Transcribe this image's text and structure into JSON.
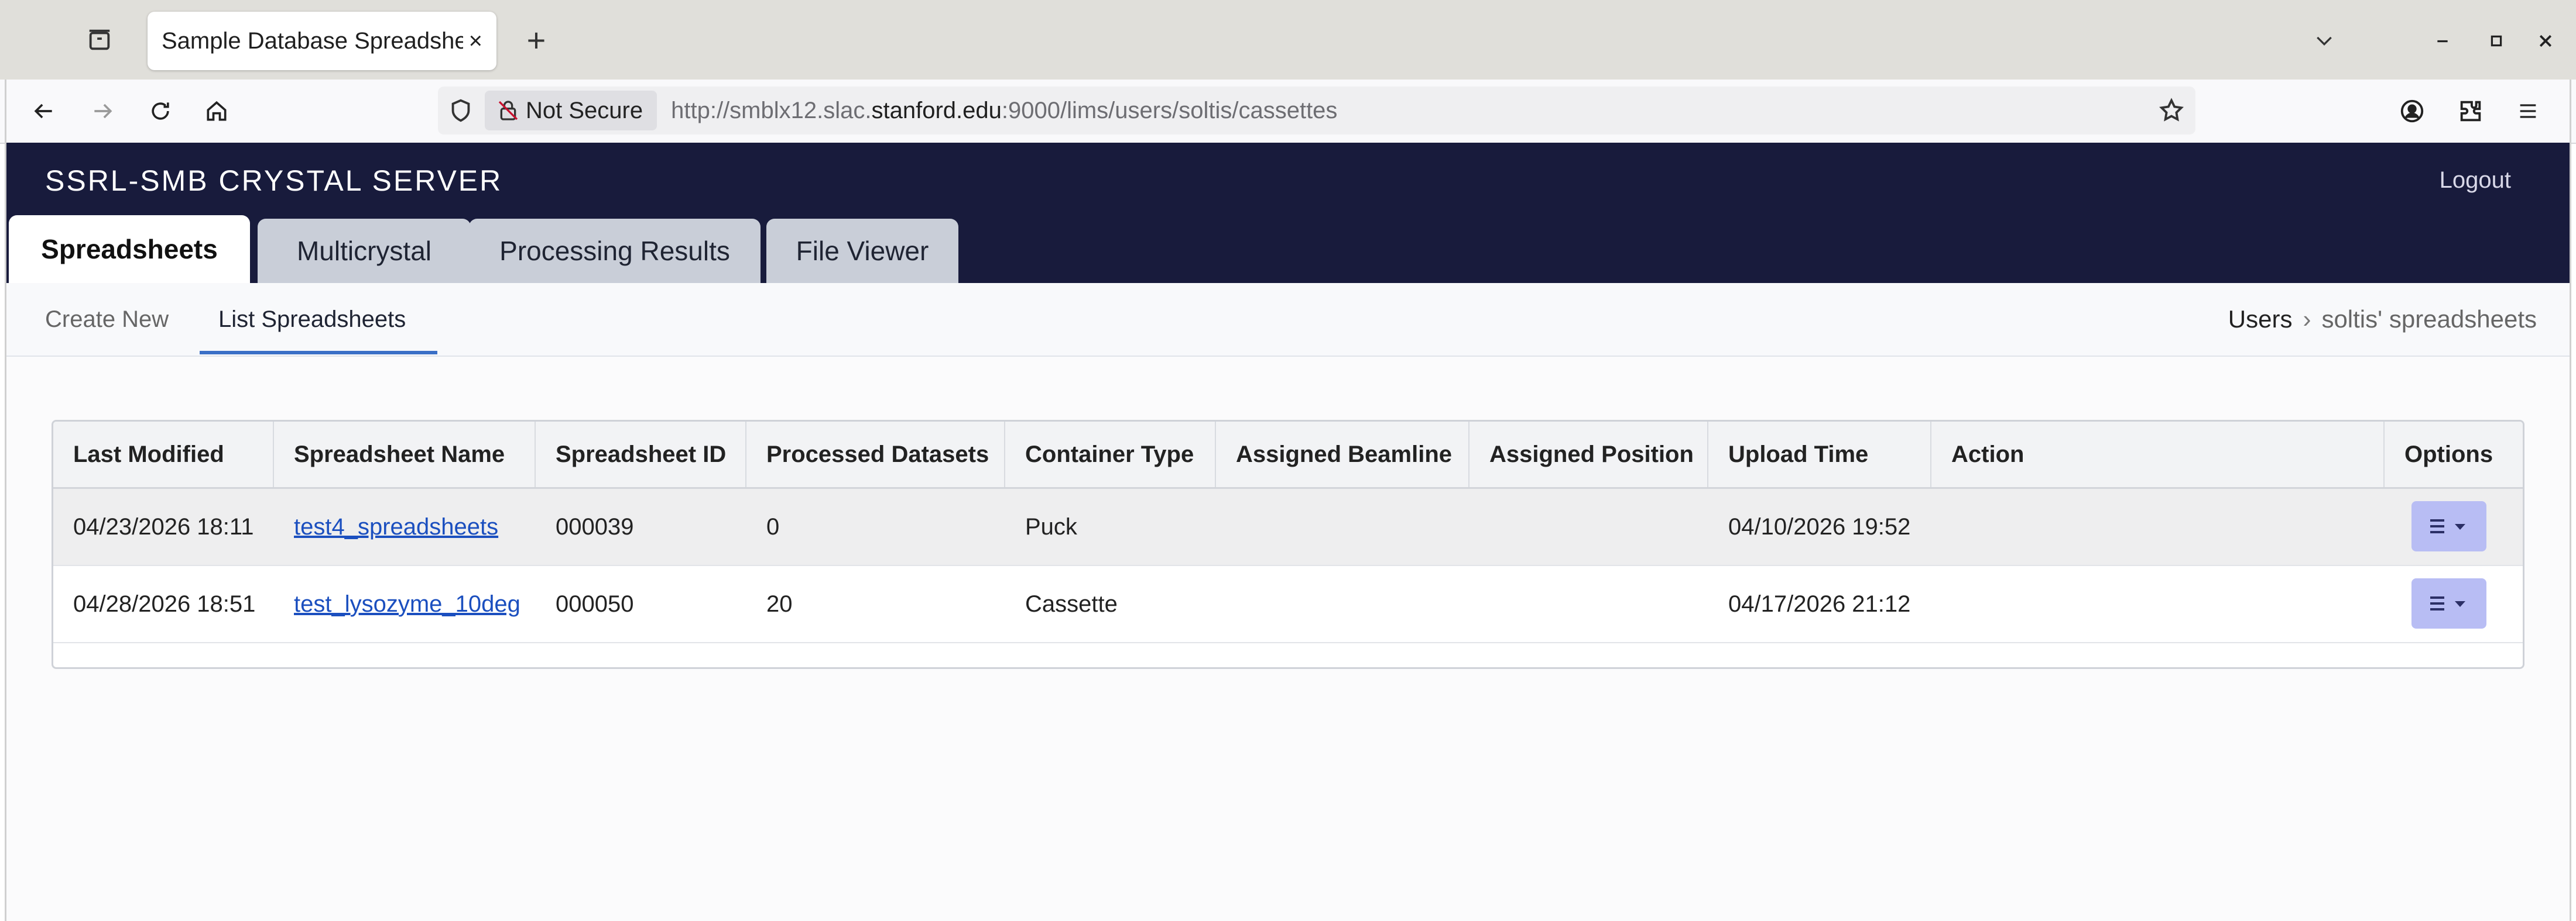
{
  "browser": {
    "tab_title": "Sample Database Spreadsheets",
    "tab_close": "×",
    "new_tab": "+",
    "not_secure": "Not Secure",
    "url_scheme": "http://smblx12.slac.",
    "url_host": "stanford.edu",
    "url_path": ":9000/lims/users/soltis/cassettes"
  },
  "app": {
    "brand": "SSRL-SMB CRYSTAL SERVER",
    "logout": "Logout",
    "tabs": [
      {
        "label": "Spreadsheets",
        "active": true
      },
      {
        "label": "Multicrystal",
        "active": false
      },
      {
        "label": "Processing Results",
        "active": false
      },
      {
        "label": "File Viewer",
        "active": false
      }
    ],
    "subnav": {
      "create_new": "Create New",
      "list_spreadsheets": "List Spreadsheets"
    },
    "breadcrumb": {
      "root": "Users",
      "separator": "›",
      "current": "soltis' spreadsheets"
    }
  },
  "table": {
    "headers": [
      "Last Modified",
      "Spreadsheet Name",
      "Spreadsheet ID",
      "Processed Datasets",
      "Container Type",
      "Assigned Beamline",
      "Assigned Position",
      "Upload Time",
      "Action",
      "Options"
    ],
    "rows": [
      {
        "last_modified": "04/23/2026 18:11",
        "name": "test4_spreadsheets",
        "id": "000039",
        "processed": "0",
        "container": "Puck",
        "beamline": "",
        "position": "",
        "upload": "04/10/2026 19:52",
        "action": ""
      },
      {
        "last_modified": "04/28/2026 18:51",
        "name": "test_lysozyme_10deg",
        "id": "000050",
        "processed": "20",
        "container": "Cassette",
        "beamline": "",
        "position": "",
        "upload": "04/17/2026 21:12",
        "action": ""
      }
    ]
  },
  "colors": {
    "header_bg": "#181b3c",
    "tab_inactive": "#c9ced8",
    "link": "#1b4fbf",
    "options_button": "#b8bdf4",
    "subnav_underline": "#3a6fc6"
  }
}
